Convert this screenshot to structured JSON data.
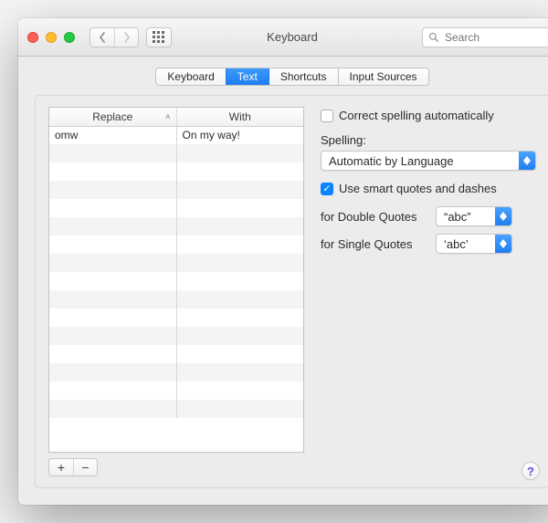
{
  "window": {
    "title": "Keyboard"
  },
  "toolbar": {
    "search_placeholder": "Search"
  },
  "tabs": {
    "keyboard": "Keyboard",
    "text": "Text",
    "shortcuts": "Shortcuts",
    "input_sources": "Input Sources",
    "active": "text"
  },
  "table": {
    "col_replace": "Replace",
    "col_with": "With",
    "rows": [
      {
        "replace": "omw",
        "with": "On my way!"
      }
    ],
    "empty_rows": 15
  },
  "buttons": {
    "add": "+",
    "remove": "−",
    "help": "?"
  },
  "options": {
    "correct_spelling_label": "Correct spelling automatically",
    "correct_spelling_checked": false,
    "spelling_label": "Spelling:",
    "spelling_value": "Automatic by Language",
    "smart_quotes_label": "Use smart quotes and dashes",
    "smart_quotes_checked": true,
    "double_quotes_label": "for Double Quotes",
    "double_quotes_value": "“abc”",
    "single_quotes_label": "for Single Quotes",
    "single_quotes_value": "‘abc’"
  }
}
